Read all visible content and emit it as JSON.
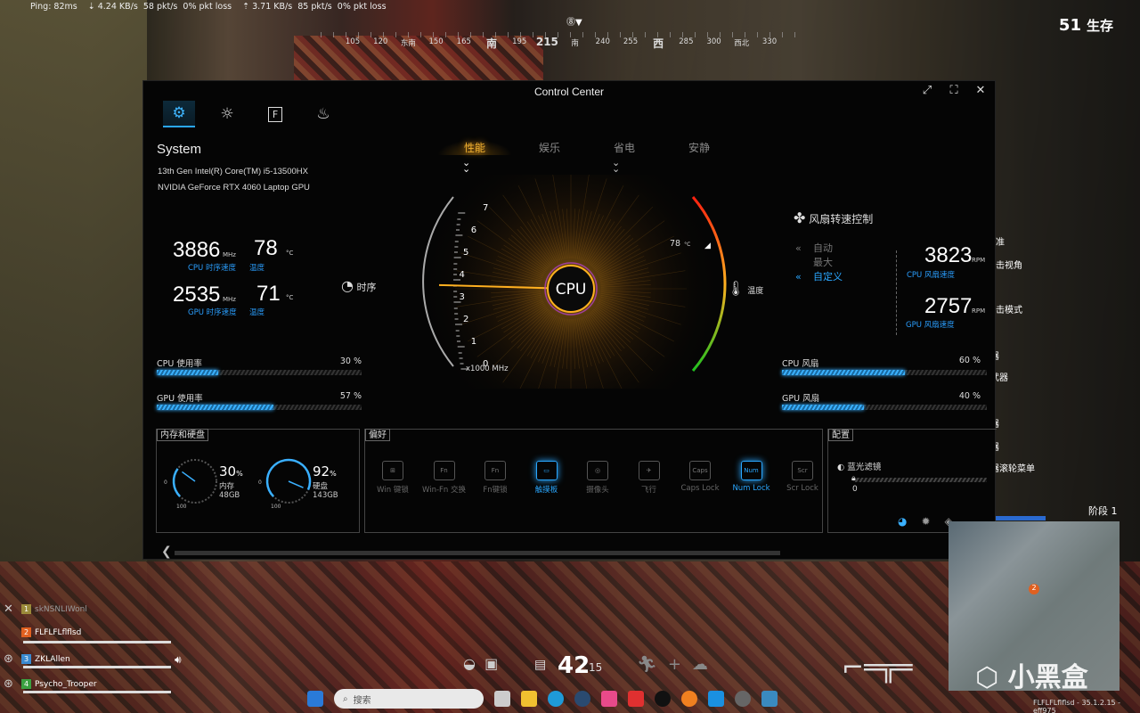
{
  "hud": {
    "ping": "Ping: 82ms",
    "down": "4.24 KB/s",
    "down_pkt": "58 pkt/s",
    "down_loss": "0% pkt loss",
    "up": "3.71 KB/s",
    "up_pkt": "85 pkt/s",
    "up_loss": "0% pkt loss",
    "alive_count": "51",
    "alive_label": "生存",
    "compass_ticks": [
      "105",
      "120",
      "东南",
      "150",
      "165",
      "南",
      "195",
      "215",
      "南",
      "240",
      "255",
      "西",
      "285",
      "300",
      "西北",
      "330"
    ],
    "compass_marker": "8",
    "right_menu": [
      "准",
      "击视角",
      "击模式",
      "器",
      "武器",
      "器",
      "器",
      "器滚轮菜单"
    ],
    "phase_label": "阶段",
    "phase_value": "1",
    "ammo": "42",
    "ammo_reserve": "15",
    "watermark": "小黑盒",
    "footer": "FLFLFLflflsd - 35.1.2.15 - eff975"
  },
  "window": {
    "title": "Control Center",
    "tabs": [
      "settings-icon",
      "lighting-icon",
      "fn-icon",
      "fan-icon"
    ]
  },
  "system": {
    "title": "System",
    "cpu_name": "13th Gen Intel(R) Core(TM) i5-13500HX",
    "gpu_name": "NVIDIA GeForce RTX 4060 Laptop GPU",
    "cpu_clock": "3886",
    "cpu_clock_unit": "MHz",
    "cpu_clock_label": "CPU 时序速度",
    "cpu_temp": "78",
    "cpu_temp_unit": "°C",
    "cpu_temp_label": "温度",
    "gpu_clock": "2535",
    "gpu_clock_unit": "MHz",
    "gpu_clock_label": "GPU 时序速度",
    "gpu_temp": "71",
    "gpu_temp_unit": "°C",
    "gpu_temp_label": "温度",
    "clock_label": "时序",
    "cpu_usage_label": "CPU 使用率",
    "cpu_usage_value": "30 %",
    "cpu_usage": 30,
    "gpu_usage_label": "GPU 使用率",
    "gpu_usage_value": "57 %",
    "gpu_usage": 57
  },
  "modes": {
    "items": [
      "性能",
      "娱乐",
      "省电",
      "安静"
    ],
    "active": 0
  },
  "gauge": {
    "center_label": "CPU",
    "ticks": [
      "0",
      "1",
      "2",
      "3",
      "4",
      "5",
      "6",
      "7"
    ],
    "unit": "x1000 MHz",
    "needle_value": 3.886,
    "temp_readout": "78",
    "temp_unit": "°C",
    "temp_label": "温度"
  },
  "fan": {
    "title": "风扇转速控制",
    "modes": [
      "自动",
      "最大",
      "自定义"
    ],
    "active_mode": 2,
    "cpu_rpm": "3823",
    "cpu_rpm_unit": "RPM",
    "cpu_rpm_label": "CPU 风扇速度",
    "gpu_rpm": "2757",
    "gpu_rpm_unit": "RPM",
    "gpu_rpm_label": "GPU 风扇速度",
    "cpu_fan_label": "CPU 风扇",
    "cpu_fan_value": "60 %",
    "cpu_fan": 60,
    "gpu_fan_label": "GPU 风扇",
    "gpu_fan_value": "40 %",
    "gpu_fan": 40
  },
  "memory": {
    "title": "内存和硬盘",
    "mem_percent": "30",
    "mem_pct_sign": "%",
    "mem_label": "内存",
    "mem_size": "48GB",
    "disk_percent": "92",
    "disk_pct_sign": "%",
    "disk_label": "硬盘",
    "disk_size": "143GB",
    "dial_min": "0",
    "dial_max": "100"
  },
  "preferences": {
    "title": "偏好",
    "items": [
      {
        "icon": "win-key-icon",
        "label": "Win 键锁",
        "glyph": "⊞"
      },
      {
        "icon": "win-fn-swap-icon",
        "label": "Win-Fn 交换",
        "glyph": "Fn"
      },
      {
        "icon": "fn-lock-icon",
        "label": "Fn键锁",
        "glyph": "Fn"
      },
      {
        "icon": "touchpad-icon",
        "label": "触摸板",
        "glyph": "▭"
      },
      {
        "icon": "camera-icon",
        "label": "摄像头",
        "glyph": "◎"
      },
      {
        "icon": "airplane-icon",
        "label": "飞行",
        "glyph": "✈"
      },
      {
        "icon": "caps-lock-icon",
        "label": "Caps Lock",
        "glyph": "Caps"
      },
      {
        "icon": "num-lock-icon",
        "label": "Num Lock",
        "glyph": "Num"
      },
      {
        "icon": "scroll-lock-icon",
        "label": "Scr Lock",
        "glyph": "Scr"
      }
    ],
    "active": [
      3,
      7
    ]
  },
  "config": {
    "title": "配置",
    "blue_light_label": "蓝光滤镜",
    "slider_value": "0"
  },
  "team": [
    {
      "num": "1",
      "name": "skNSNLIWonl",
      "color": "#9a8a3a"
    },
    {
      "num": "2",
      "name": "FLFLFLflflsd",
      "color": "#e06020"
    },
    {
      "num": "3",
      "name": "ZKLAllen",
      "color": "#3a8ad0"
    },
    {
      "num": "4",
      "name": "Psycho_Trooper",
      "color": "#3aa040"
    }
  ],
  "taskbar": {
    "search_placeholder": "搜索"
  }
}
